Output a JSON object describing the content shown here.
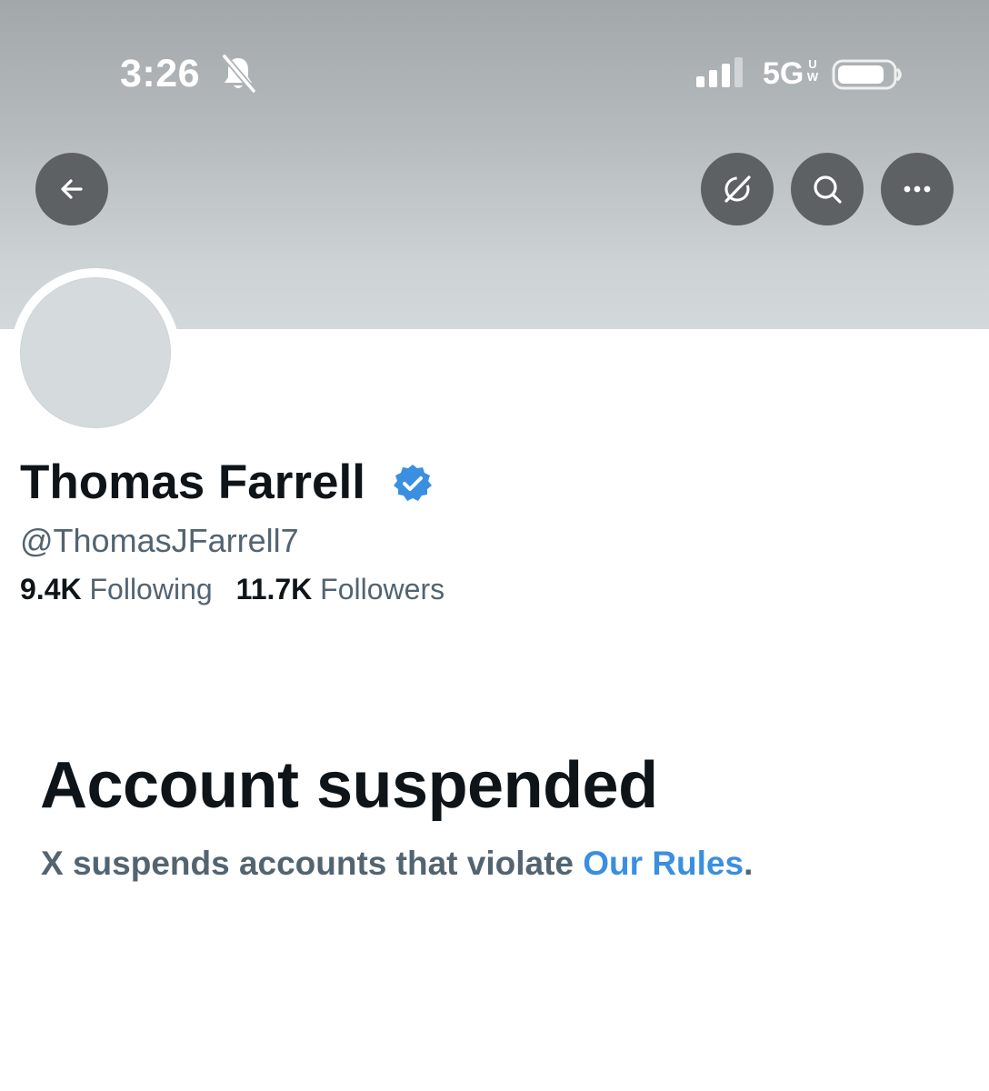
{
  "status_bar": {
    "time": "3:26",
    "network": "5G",
    "network_sub_top": "U",
    "network_sub_bottom": "W",
    "icons": [
      "bell-slash-icon",
      "signal-bars-icon",
      "battery-icon"
    ]
  },
  "header": {
    "buttons": [
      {
        "name": "back",
        "icon": "arrow-left-icon"
      },
      {
        "name": "grok",
        "icon": "grok-icon"
      },
      {
        "name": "search",
        "icon": "search-icon"
      },
      {
        "name": "more",
        "icon": "ellipsis-icon"
      }
    ]
  },
  "profile": {
    "display_name": "Thomas Farrell",
    "verified": true,
    "handle": "@ThomasJFarrell7",
    "following_count": "9.4K",
    "following_label": "Following",
    "followers_count": "11.7K",
    "followers_label": "Followers"
  },
  "suspension": {
    "title": "Account suspended",
    "description": "X suspends accounts that violate ",
    "link_text": "Our Rules",
    "period": "."
  },
  "colors": {
    "text_primary": "#0f1419",
    "text_secondary": "#536471",
    "link": "#3a8fe0",
    "verified_badge": "#3a8fe0",
    "nav_button_bg": "#5d6164"
  }
}
